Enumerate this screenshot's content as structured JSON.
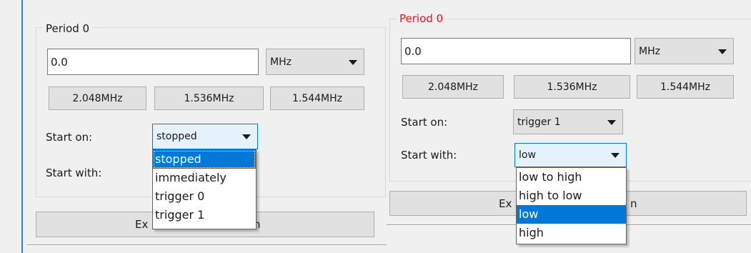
{
  "left_panel": {
    "group_title": "Period 0",
    "frequency_value": "0.0",
    "unit": "MHz",
    "presets": [
      "2.048MHz",
      "1.536MHz",
      "1.544MHz"
    ],
    "start_on_label": "Start on:",
    "start_on_value": "stopped",
    "start_with_label": "Start with:",
    "start_on_options": [
      "stopped",
      "immediately",
      "trigger 0",
      "trigger 1"
    ],
    "button_left": "Ex",
    "button_right": "n"
  },
  "right_panel": {
    "group_title": "Period 0",
    "frequency_value": "0.0",
    "unit": "MHz",
    "presets": [
      "2.048MHz",
      "1.536MHz",
      "1.544MHz"
    ],
    "start_on_label": "Start on:",
    "start_on_value": "trigger 1",
    "start_with_label": "Start with:",
    "start_with_value": "low",
    "start_with_options": [
      "low to high",
      "high to low",
      "low",
      "high"
    ],
    "button_left": "Ex",
    "button_right": "n"
  },
  "colors": {
    "accent": "#0078d7",
    "title_error": "#e81123",
    "edge": "#3c7bd0"
  }
}
